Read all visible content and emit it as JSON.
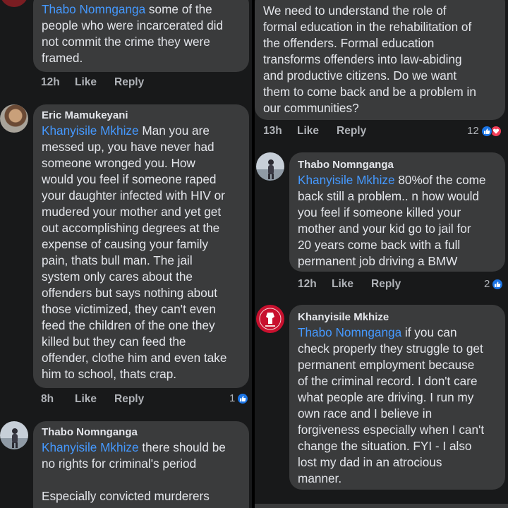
{
  "left": {
    "c1": {
      "mention": "Thabo Nomnganga",
      "text_first": " some of the",
      "lines": [
        "people who were incarcerated did",
        "not commit the crime they were",
        "framed."
      ],
      "time": "12h",
      "like": "Like",
      "reply": "Reply"
    },
    "c2": {
      "author": "Eric Mamukeyani",
      "mention": "Khanyisile Mkhize",
      "text_first": " Man you are",
      "lines": [
        "messed up, you have never had",
        "someone wronged you. How",
        "would you feel if someone raped",
        "your daughter infected with HIV or",
        "mudered your mother and yet get",
        "out accomplishing degrees at the",
        "expense of causing your family",
        "pain, thats bull man. The jail",
        "system only cares about the",
        "offenders but says nothing about",
        "those victimized, they can't even",
        "feed the children of the one they",
        "killed but they can feed the",
        "offender, clothe him and even take",
        "him to school, thats crap."
      ],
      "time": "8h",
      "like": "Like",
      "reply": "Reply",
      "reactions": "1"
    },
    "c3": {
      "author": "Thabo Nomnganga",
      "mention": "Khanyisile Mkhize",
      "text_first": " there should be",
      "lines": [
        "no rights for criminal's period",
        "",
        "Especially convicted murderers"
      ]
    }
  },
  "right": {
    "c1": {
      "lines": [
        "We need to understand the role of",
        "formal education in the rehabilitation of",
        "the offenders. Formal education",
        "transforms offenders into law-abiding",
        "and productive citizens. Do we want",
        "them to come back and be a problem in",
        "our communities?"
      ],
      "time": "13h",
      "like": "Like",
      "reply": "Reply",
      "reactions": "12"
    },
    "c2": {
      "author": "Thabo Nomnganga",
      "mention": "Khanyisile Mkhize",
      "text_first": " 80%of the come",
      "lines": [
        "back still a problem.. n how would",
        "you feel if someone killed your",
        "mother and your kid go to jail for",
        "20 years come back with a full",
        "permanent job driving a BMW"
      ],
      "time": "12h",
      "like": "Like",
      "reply": "Reply",
      "reactions": "2"
    },
    "c3": {
      "author": "Khanyisile Mkhize",
      "mention": "Thabo Nomnganga",
      "text_first": " if you can",
      "lines": [
        "check properly they struggle to get",
        "permanent employment because",
        "of the criminal record. I don't care",
        "what people are driving. I run my",
        "own race and I believe in",
        "forgiveness especially when I can't",
        "change the situation. FYI - I also",
        "lost my dad  in an atrocious",
        "manner."
      ]
    }
  },
  "colors": {
    "background": "#18191a",
    "bubble": "#3a3b3c",
    "mention": "#4599ff",
    "meta": "#b0b3b8",
    "like": "#1b74e4",
    "love": "#f33e58"
  }
}
